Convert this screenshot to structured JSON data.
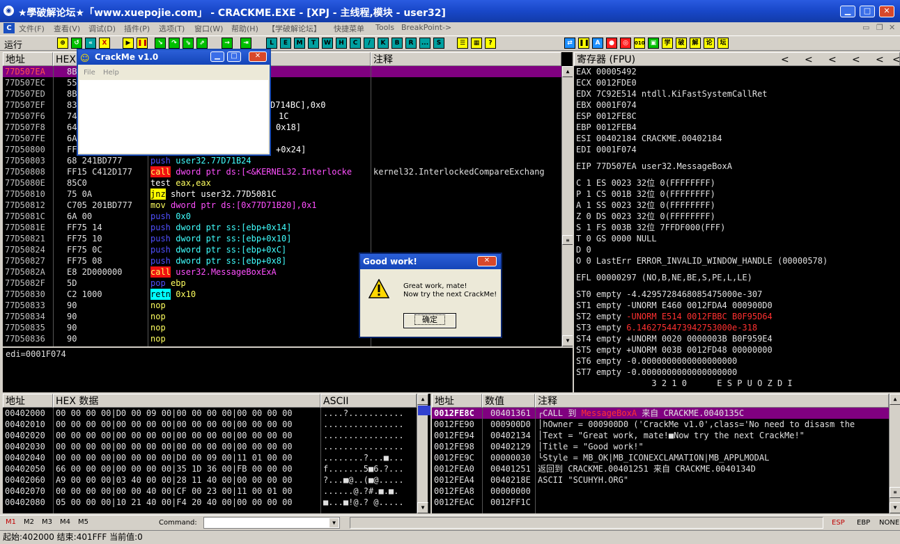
{
  "window": {
    "title": "★學破解论坛★「www.xuepojie.com」 - CRACKME.EXE - [XPJ - 主线程,模块 - user32]"
  },
  "menu": [
    "文件(F)",
    "查看(V)",
    "调试(D)",
    "插件(P)",
    "选项(T)",
    "窗口(W)",
    "帮助(H)",
    "【学破解论坛】",
    "快捷菜单",
    "Tools",
    "BreakPoint->"
  ],
  "toolbar": {
    "status": "运行",
    "letters": [
      "L",
      "E",
      "M",
      "T",
      "W",
      "H",
      "C",
      "/",
      "K",
      "B",
      "R",
      "...",
      "S"
    ],
    "right_chars": [
      "学",
      "破",
      "解",
      "论",
      "坛"
    ]
  },
  "disasm": {
    "headers": {
      "addr": "地址",
      "hex": "HEX",
      "comment": "注释"
    },
    "rows": [
      {
        "addr": "77D507EA",
        "hex": "8B",
        "asm": "",
        "op": ""
      },
      {
        "addr": "77D507EC",
        "hex": "55",
        "asm": "",
        "op": ""
      },
      {
        "addr": "77D507ED",
        "hex": "8B",
        "asm": "",
        "op": ""
      },
      {
        "addr": "77D507EF",
        "hex": "83",
        "asm": "",
        "op": "D714BC],0x0"
      },
      {
        "addr": "77D507F6",
        "hex": "74",
        "asm": "",
        "op": "1C"
      },
      {
        "addr": "77D507F8",
        "hex": "64",
        "asm": "",
        "op": "0x18]"
      },
      {
        "addr": "77D507FE",
        "hex": "6A",
        "asm": "",
        "op": ""
      },
      {
        "addr": "77D50800",
        "hex": "FF",
        "asm": "",
        "op": "+0x24]"
      },
      {
        "addr": "77D50803",
        "hex": "68 241BD777",
        "asm": "push",
        "op": "user32.77D71B24"
      },
      {
        "addr": "77D50808",
        "hex": "FF15 C412D177",
        "asm": "call",
        "op": "dword ptr ds:[<&KERNEL32.Interlocke"
      },
      {
        "addr": "77D5080E",
        "hex": "85C0",
        "asm": "test",
        "op": "eax,eax"
      },
      {
        "addr": "77D50810",
        "hex": "75 0A",
        "asm": "jnz",
        "op": "short user32.77D5081C"
      },
      {
        "addr": "77D50812",
        "hex": "C705 201BD777",
        "asm": "mov",
        "op": "dword ptr ds:[0x77D71B20],0x1"
      },
      {
        "addr": "77D5081C",
        "hex": "6A 00",
        "asm": "push",
        "op": "0x0"
      },
      {
        "addr": "77D5081E",
        "hex": "FF75 14",
        "asm": "push",
        "op": "dword ptr ss:[ebp+0x14]"
      },
      {
        "addr": "77D50821",
        "hex": "FF75 10",
        "asm": "push",
        "op": "dword ptr ss:[ebp+0x10]"
      },
      {
        "addr": "77D50824",
        "hex": "FF75 0C",
        "asm": "push",
        "op": "dword ptr ss:[ebp+0xC]"
      },
      {
        "addr": "77D50827",
        "hex": "FF75 08",
        "asm": "push",
        "op": "dword ptr ss:[ebp+0x8]"
      },
      {
        "addr": "77D5082A",
        "hex": "E8 2D000000",
        "asm": "call",
        "op": "user32.MessageBoxExA"
      },
      {
        "addr": "77D5082F",
        "hex": "5D",
        "asm": "pop",
        "op": "ebp"
      },
      {
        "addr": "77D50830",
        "hex": "C2 1000",
        "asm": "retn",
        "op": "0x10"
      },
      {
        "addr": "77D50833",
        "hex": "90",
        "asm": "nop",
        "op": ""
      },
      {
        "addr": "77D50834",
        "hex": "90",
        "asm": "nop",
        "op": ""
      },
      {
        "addr": "77D50835",
        "hex": "90",
        "asm": "nop",
        "op": ""
      },
      {
        "addr": "77D50836",
        "hex": "90",
        "asm": "nop",
        "op": ""
      }
    ],
    "comment_row9": "kernel32.InterlockedCompareExchang",
    "info": "edi=0001F074"
  },
  "registers": {
    "header": "寄存器 (FPU)",
    "nav": [
      "<",
      "<",
      "<",
      "<",
      "<",
      "<"
    ],
    "lines": [
      "EAX 00005492",
      "ECX 0012FDE0",
      "EDX 7C92E514 ntdll.KiFastSystemCallRet",
      "EBX 0001F074",
      "ESP 0012FE8C",
      "EBP 0012FEB4",
      "ESI 00402184 CRACKME.00402184",
      "EDI 0001F074",
      "",
      "EIP 77D507EA user32.MessageBoxA",
      "",
      "C 1  ES 0023 32位 0(FFFFFFFF)",
      "P 1  CS 001B 32位 0(FFFFFFFF)",
      "A 1  SS 0023 32位 0(FFFFFFFF)",
      "Z 0  DS 0023 32位 0(FFFFFFFF)",
      "S 1  FS 003B 32位 7FFDF000(FFF)",
      "T 0  GS 0000 NULL",
      "D 0",
      "O 0  LastErr ERROR_INVALID_WINDOW_HANDLE (00000578)",
      "",
      "EFL 00000297 (NO,B,NE,BE,S,PE,L,LE)",
      "",
      "ST0 empty -4.4295728468085475000e-307",
      "ST1 empty -UNORM E460 0012FDA4 000900D0"
    ],
    "st2": "ST2 empty ",
    "st2_red": "-UNORM E514 0012FBBC B0F95D64",
    "st3": "ST3 empty ",
    "st3_red": "6.1462754473942753000e-318",
    "lines2": [
      "ST4 empty +UNORM 0020 0000003B B0F959E4",
      "ST5 empty +UNORM 003B 0012FD48 00000000",
      "ST6 empty -0.0000000000000000000",
      "ST7 empty -0.0000000000000000000",
      "               3 2 1 0      E S P U O Z D I"
    ]
  },
  "dump": {
    "headers": {
      "addr": "地址",
      "hex": "HEX 数据",
      "ascii": "ASCII"
    },
    "rows": [
      {
        "addr": "00402000",
        "hex": "00 00 00 00|D0 00 09 00|00 00 00 00|00 00 00 00",
        "ascii": "....?..........."
      },
      {
        "addr": "00402010",
        "hex": "00 00 00 00|00 00 00 00|00 00 00 00|00 00 00 00",
        "ascii": "................"
      },
      {
        "addr": "00402020",
        "hex": "00 00 00 00|00 00 00 00|00 00 00 00|00 00 00 00",
        "ascii": "................"
      },
      {
        "addr": "00402030",
        "hex": "00 00 00 00|00 00 00 00|00 00 00 00|00 00 00 00",
        "ascii": "................"
      },
      {
        "addr": "00402040",
        "hex": "00 00 00 00|00 00 00 00|D0 00 09 00|11 01 00 00",
        "ascii": "........?...■..."
      },
      {
        "addr": "00402050",
        "hex": "66 00 00 00|00 00 00 00|35 1D 36 00|FB 00 00 00",
        "ascii": "f.......5■6.?..."
      },
      {
        "addr": "00402060",
        "hex": "A9 00 00 00|03 40 00 00|28 11 40 00|00 00 00 00",
        "ascii": "?...■@..(■@....."
      },
      {
        "addr": "00402070",
        "hex": "00 00 00 00|00 00 40 00|CF 00 23 00|11 00 01 00",
        "ascii": "......@.?#.■.■."
      },
      {
        "addr": "00402080",
        "hex": "05 00 00 00|10 21 40 00|F4 20 40 00|00 00 00 00",
        "ascii": "■...■!@.? @....."
      }
    ]
  },
  "stack": {
    "headers": {
      "addr": "地址",
      "val": "数值",
      "comment": "注释"
    },
    "rows": [
      {
        "addr": "0012FE8C",
        "val": "00401361",
        "c1": "┌CALL 到 ",
        "c2": "MessageBoxA",
        "c3": " 来自 CRACKME.0040135C"
      },
      {
        "addr": "0012FE90",
        "val": "000900D0",
        "c1": "│hOwner = 000900D0 ('CrackMe v1.0',class='No need to disasm the",
        "c2": "",
        "c3": ""
      },
      {
        "addr": "0012FE94",
        "val": "00402134",
        "c1": "│Text = \"Great work, mate!■Now try the next CrackMe!\"",
        "c2": "",
        "c3": ""
      },
      {
        "addr": "0012FE98",
        "val": "00402129",
        "c1": "│Title = \"Good work!\"",
        "c2": "",
        "c3": ""
      },
      {
        "addr": "0012FE9C",
        "val": "00000030",
        "c1": "└Style = MB_OK|MB_ICONEXCLAMATION|MB_APPLMODAL",
        "c2": "",
        "c3": ""
      },
      {
        "addr": "0012FEA0",
        "val": "00401251",
        "c1": "返回到 CRACKME.00401251 来自 CRACKME.0040134D",
        "c2": "",
        "c3": ""
      },
      {
        "addr": "0012FEA4",
        "val": "0040218E",
        "c1": "ASCII \"SCUHYH.ORG\"",
        "c2": "",
        "c3": ""
      },
      {
        "addr": "0012FEA8",
        "val": "00000000",
        "c1": "",
        "c2": "",
        "c3": ""
      },
      {
        "addr": "0012FEAC",
        "val": "0012FF1C",
        "c1": "",
        "c2": "",
        "c3": ""
      }
    ]
  },
  "crackme": {
    "title": "CrackMe v1.0",
    "menu": [
      "File",
      "Help"
    ]
  },
  "msgbox": {
    "title": "Good work!",
    "line1": "Great work, mate!",
    "line2": "Now try the next CrackMe!",
    "ok": "确定"
  },
  "status": {
    "m": [
      "M1",
      "M2",
      "M3",
      "M4",
      "M5"
    ],
    "command_label": "Command:",
    "regs": [
      "ESP",
      "EBP",
      "NONE"
    ],
    "bottom": "起始:402000 结束:401FFF 当前值:0"
  }
}
